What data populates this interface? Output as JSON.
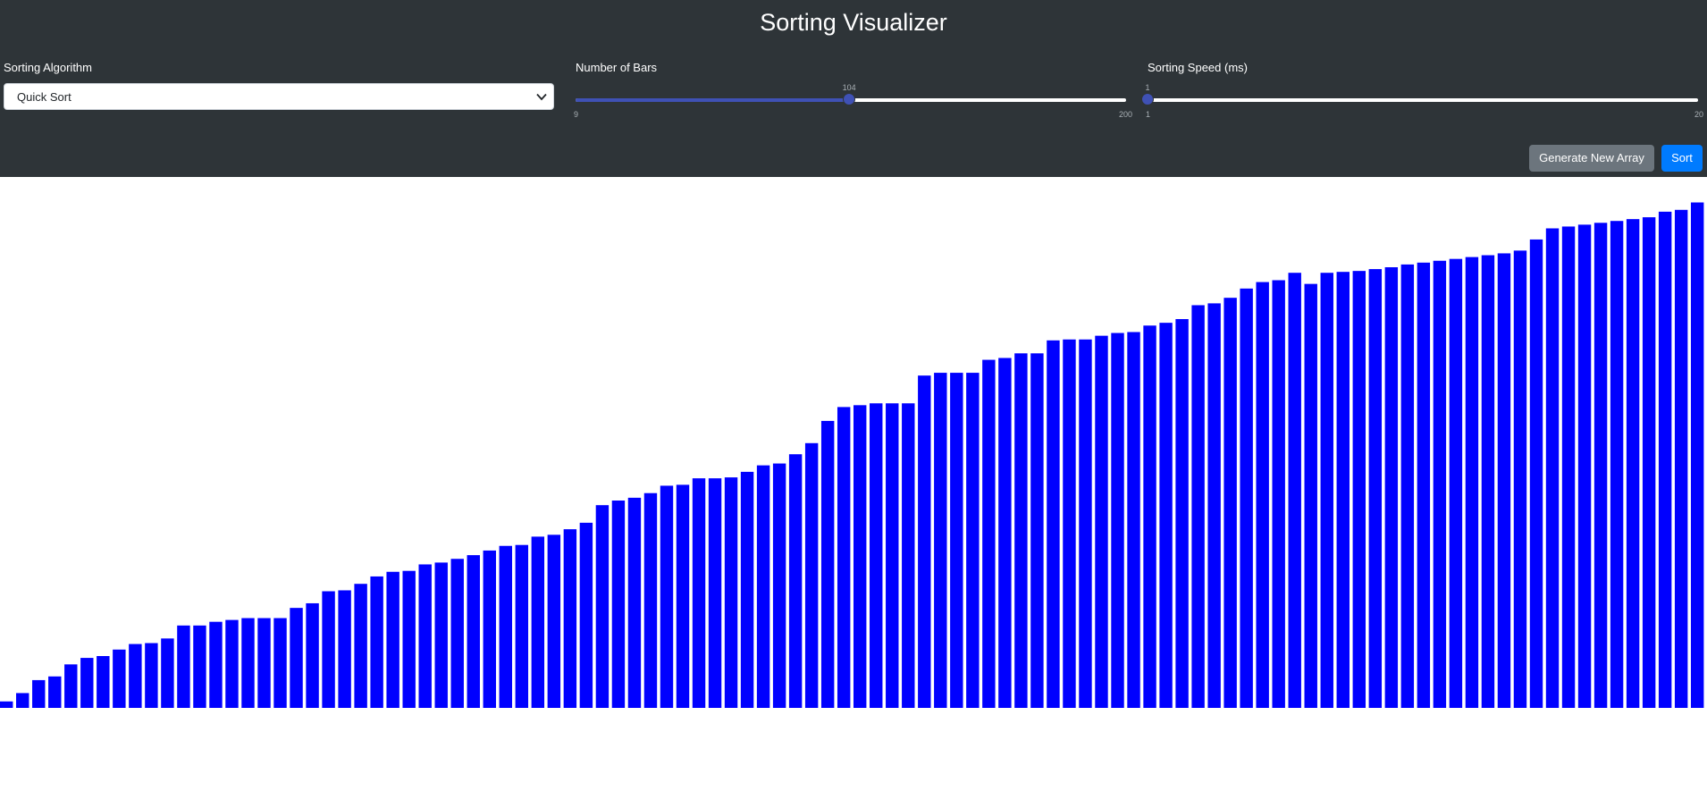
{
  "app": {
    "title": "Sorting Visualizer"
  },
  "controls": {
    "algorithm": {
      "label": "Sorting Algorithm",
      "value": "Quick Sort"
    },
    "bars": {
      "label": "Number of Bars",
      "min": "9",
      "max": "200",
      "value": "104",
      "fraction": 0.497
    },
    "speed": {
      "label": "Sorting Speed (ms)",
      "min": "1",
      "max": "20",
      "value": "1",
      "fraction": 0
    }
  },
  "buttons": {
    "generate": "Generate New Array",
    "sort": "Sort"
  },
  "colors": {
    "header_bg": "#2e3438",
    "bar": "#0000ff",
    "slider_fill": "#3f51b5",
    "generate_button": "#6c757d",
    "sort_button": "#007bff"
  },
  "chart_data": {
    "type": "bar",
    "count": 104,
    "values": [
      7,
      16,
      30,
      34,
      47,
      54,
      56,
      63,
      69,
      70,
      75,
      89,
      89,
      93,
      95,
      97,
      97,
      97,
      108,
      113,
      126,
      127,
      134,
      142,
      147,
      148,
      155,
      157,
      161,
      165,
      170,
      175,
      176,
      185,
      187,
      193,
      200,
      219,
      224,
      227,
      232,
      240,
      241,
      248,
      248,
      249,
      255,
      262,
      264,
      274,
      286,
      310,
      325,
      327,
      329,
      329,
      329,
      359,
      362,
      362,
      362,
      376,
      378,
      383,
      383,
      397,
      398,
      398,
      402,
      405,
      406,
      413,
      416,
      420,
      435,
      437,
      443,
      453,
      460,
      462,
      470,
      458,
      470,
      471,
      472,
      474,
      476,
      479,
      481,
      483,
      485,
      487,
      489,
      491,
      494,
      506,
      518,
      520,
      522,
      524,
      526,
      528,
      530,
      536,
      538,
      546
    ],
    "ylim": [
      0,
      560
    ]
  }
}
